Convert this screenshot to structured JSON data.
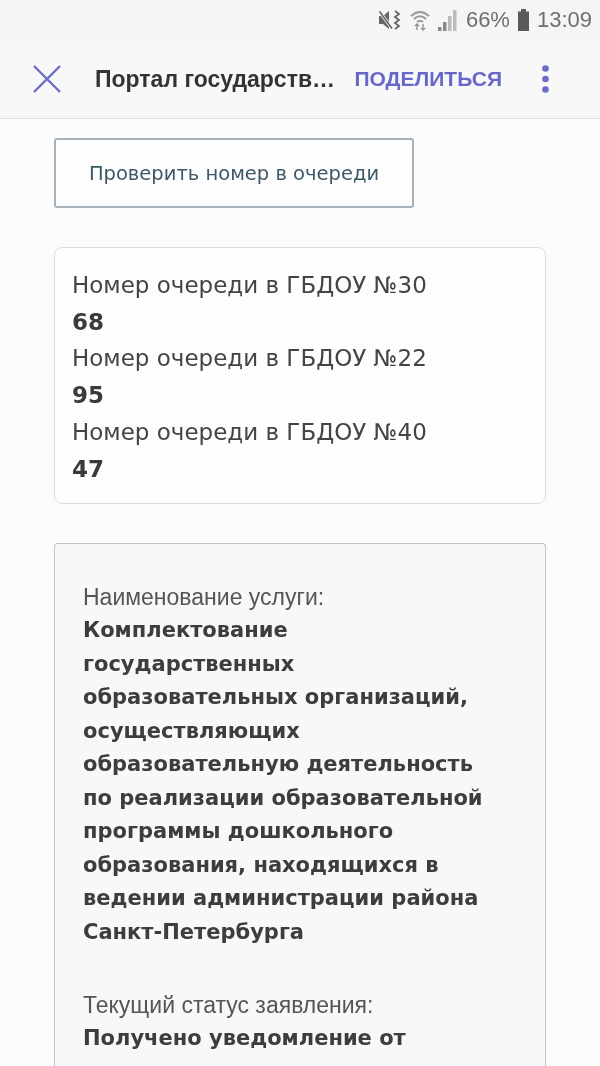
{
  "status_bar": {
    "battery": "66%",
    "time": "13:09"
  },
  "app_bar": {
    "title": "Портал государств…",
    "share_action": "ПОДЕЛИТЬСЯ"
  },
  "check_button": {
    "label": "Проверить номер в очереди"
  },
  "queue_card": {
    "entries": [
      {
        "label": "Номер очереди в ГБДОУ №30",
        "value": "68"
      },
      {
        "label": "Номер очереди в ГБДОУ №22",
        "value": "95"
      },
      {
        "label": "Номер очереди в ГБДОУ №40",
        "value": "47"
      }
    ]
  },
  "application_card": {
    "fields": [
      {
        "label": "Наименование услуги:",
        "value": "Комплектование государственных образовательных организаций, осуществляющих образовательную деятельность по реализации образовательной программы дошкольного образования, находящихся в ведении администрации района Санкт-Петербурга"
      },
      {
        "label": "Текущий статус заявления:",
        "value": "Получено уведомление от"
      }
    ]
  }
}
